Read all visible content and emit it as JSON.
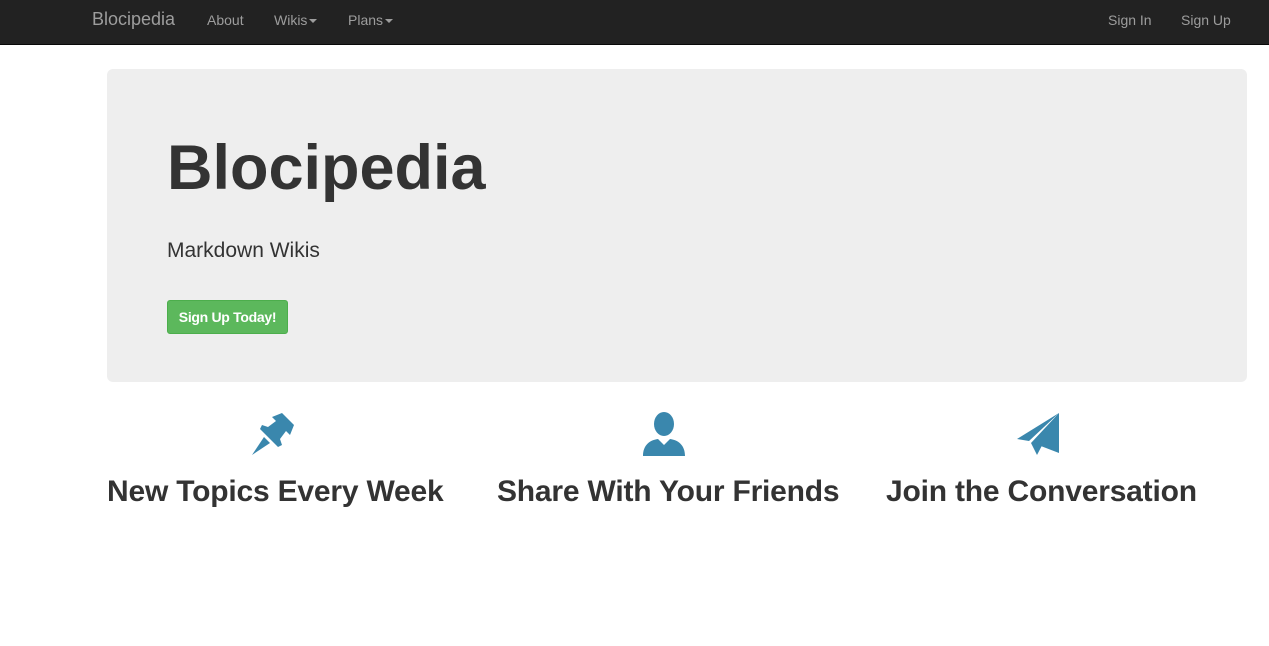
{
  "navbar": {
    "brand": "Blocipedia",
    "links": {
      "about": "About",
      "wikis": "Wikis",
      "plans": "Plans",
      "sign_in": "Sign In",
      "sign_up": "Sign Up"
    }
  },
  "hero": {
    "title": "Blocipedia",
    "subtitle": "Markdown Wikis",
    "cta_label": "Sign Up Today!"
  },
  "features": [
    {
      "icon": "pushpin-icon",
      "heading": "New Topics Every Week"
    },
    {
      "icon": "user-icon",
      "heading": "Share With Your Friends"
    },
    {
      "icon": "paper-plane-icon",
      "heading": "Join the Conversation"
    }
  ],
  "colors": {
    "navbar_bg": "#222222",
    "nav_text": "#9d9d9d",
    "jumbotron_bg": "#eeeeee",
    "button_green": "#5cb85c",
    "icon_blue": "#3a87ad",
    "text": "#333333"
  }
}
